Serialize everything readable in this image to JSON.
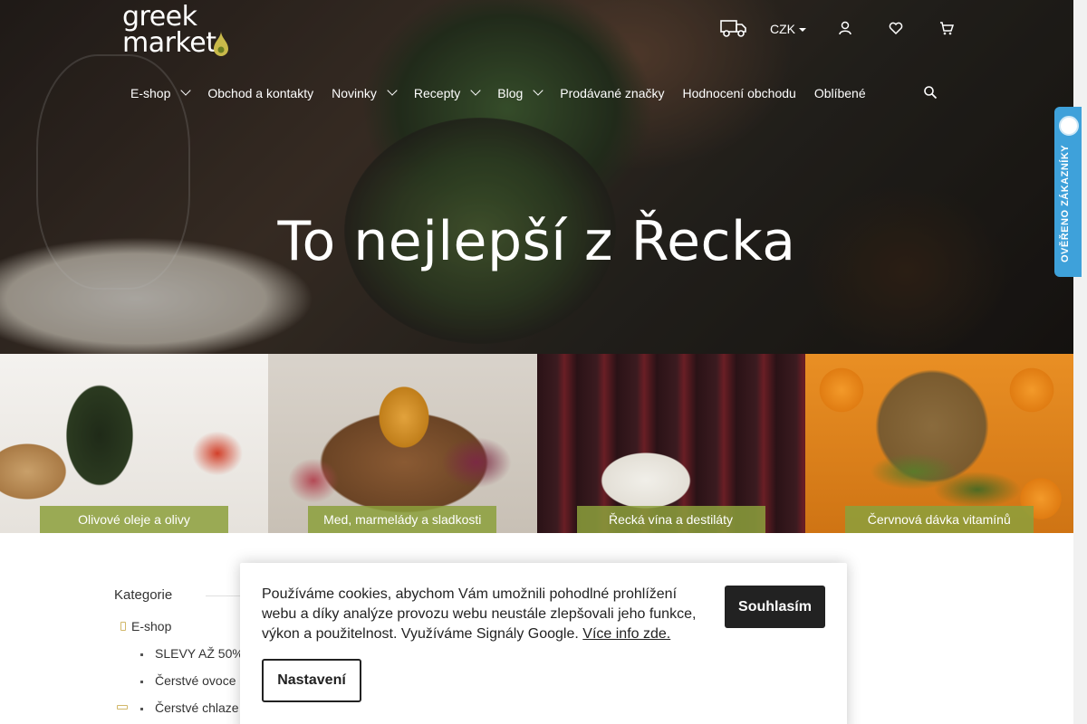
{
  "logo": {
    "line1": "greek",
    "line2": "market"
  },
  "header": {
    "currency": "CZK",
    "icons": [
      "truck-icon",
      "user-icon",
      "heart-icon",
      "cart-icon"
    ]
  },
  "nav": {
    "items": [
      {
        "label": "E-shop",
        "has_dropdown": true
      },
      {
        "label": "Obchod a kontakty",
        "has_dropdown": false
      },
      {
        "label": "Novinky",
        "has_dropdown": true
      },
      {
        "label": "Recepty",
        "has_dropdown": true
      },
      {
        "label": "Blog",
        "has_dropdown": true
      },
      {
        "label": "Prodávané značky",
        "has_dropdown": false
      },
      {
        "label": "Hodnocení obchodu",
        "has_dropdown": false
      },
      {
        "label": "Oblíbené",
        "has_dropdown": false
      }
    ]
  },
  "hero": {
    "title": "To nejlepší z Řecka"
  },
  "verified_badge": {
    "text": "OVĚŘENO ZÁKAZNÍKY"
  },
  "tiles": [
    {
      "label": "Olivové oleje a olivy"
    },
    {
      "label": "Med, marmelády a sladkosti"
    },
    {
      "label": "Řecká vína a destiláty"
    },
    {
      "label": "Červnová dávka vitamínů"
    }
  ],
  "sidebar": {
    "heading": "Kategorie",
    "root": "E-shop",
    "items": [
      "SLEVY AŽ 50%",
      "Čerstvé ovoce",
      "Čerstvé chlaze"
    ]
  },
  "cookie": {
    "text": "Používáme cookies, abychom Vám umožnili pohodlné prohlížení webu a díky analýze provozu webu neustále zlepšovali jeho funkce, výkon a použitelnost. Využíváme Signály Google.",
    "link": "Více info zde.",
    "accept": "Souhlasím",
    "settings": "Nastavení"
  },
  "colors": {
    "tile_label_bg": "#8ca03c",
    "badge_blue": "#3ea1da",
    "button_dark": "#222222"
  }
}
